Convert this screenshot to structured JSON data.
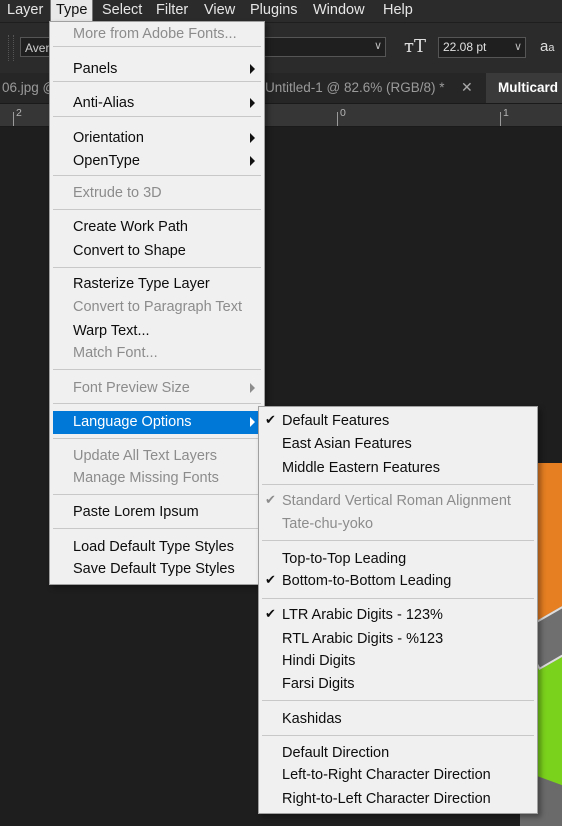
{
  "menubar": {
    "items": [
      "Layer",
      "Type",
      "Select",
      "Filter",
      "View",
      "Plugins",
      "Window",
      "Help"
    ],
    "active": "Type"
  },
  "options_bar": {
    "font_family": "Aven",
    "font_size": "22.08 pt",
    "font_size_icon": "font-size-icon",
    "antialias_icon": "anti-alias-icon"
  },
  "tabs": [
    {
      "label": "06.jpg @"
    },
    {
      "label": "Untitled-1 @ 82.6% (RGB/8) *"
    },
    {
      "label": "Multicard"
    }
  ],
  "ruler": {
    "labels": [
      "2",
      "0",
      "1"
    ]
  },
  "type_menu": {
    "items": [
      {
        "label": "More from Adobe Fonts...",
        "disabled": true
      },
      {
        "label": "Panels",
        "submenu": true
      },
      {
        "label": "Anti-Alias",
        "submenu": true
      },
      {
        "label": "Orientation",
        "submenu": true
      },
      {
        "label": "OpenType",
        "submenu": true
      },
      {
        "label": "Extrude to 3D",
        "disabled": true
      },
      {
        "label": "Create Work Path"
      },
      {
        "label": "Convert to Shape"
      },
      {
        "label": "Rasterize Type Layer"
      },
      {
        "label": "Convert to Paragraph Text",
        "disabled": true
      },
      {
        "label": "Warp Text..."
      },
      {
        "label": "Match Font...",
        "disabled": true
      },
      {
        "label": "Font Preview Size",
        "disabled": true,
        "submenu": true
      },
      {
        "label": "Language Options",
        "submenu": true,
        "highlighted": true
      },
      {
        "label": "Update All Text Layers",
        "disabled": true
      },
      {
        "label": "Manage Missing Fonts",
        "disabled": true
      },
      {
        "label": "Paste Lorem Ipsum"
      },
      {
        "label": "Load Default Type Styles"
      },
      {
        "label": "Save Default Type Styles"
      }
    ]
  },
  "language_submenu": {
    "items": [
      {
        "label": "Default Features",
        "checked": true
      },
      {
        "label": "East Asian Features"
      },
      {
        "label": "Middle Eastern Features"
      },
      {
        "label": "Standard Vertical Roman Alignment",
        "checked": true,
        "disabled": true
      },
      {
        "label": "Tate-chu-yoko",
        "disabled": true
      },
      {
        "label": "Top-to-Top Leading"
      },
      {
        "label": "Bottom-to-Bottom Leading",
        "checked": true
      },
      {
        "label": "LTR Arabic Digits - 123%",
        "checked": true
      },
      {
        "label": "RTL Arabic Digits - %123"
      },
      {
        "label": "Hindi Digits"
      },
      {
        "label": "Farsi Digits"
      },
      {
        "label": "Kashidas"
      },
      {
        "label": "Default Direction"
      },
      {
        "label": "Left-to-Right Character Direction"
      },
      {
        "label": "Right-to-Left Character Direction"
      }
    ]
  },
  "colors": {
    "highlight": "#0078d7",
    "menu_bg": "#f0f0f0",
    "disabled_text": "#8c8c8c",
    "app_bg": "#1e1e1e"
  }
}
